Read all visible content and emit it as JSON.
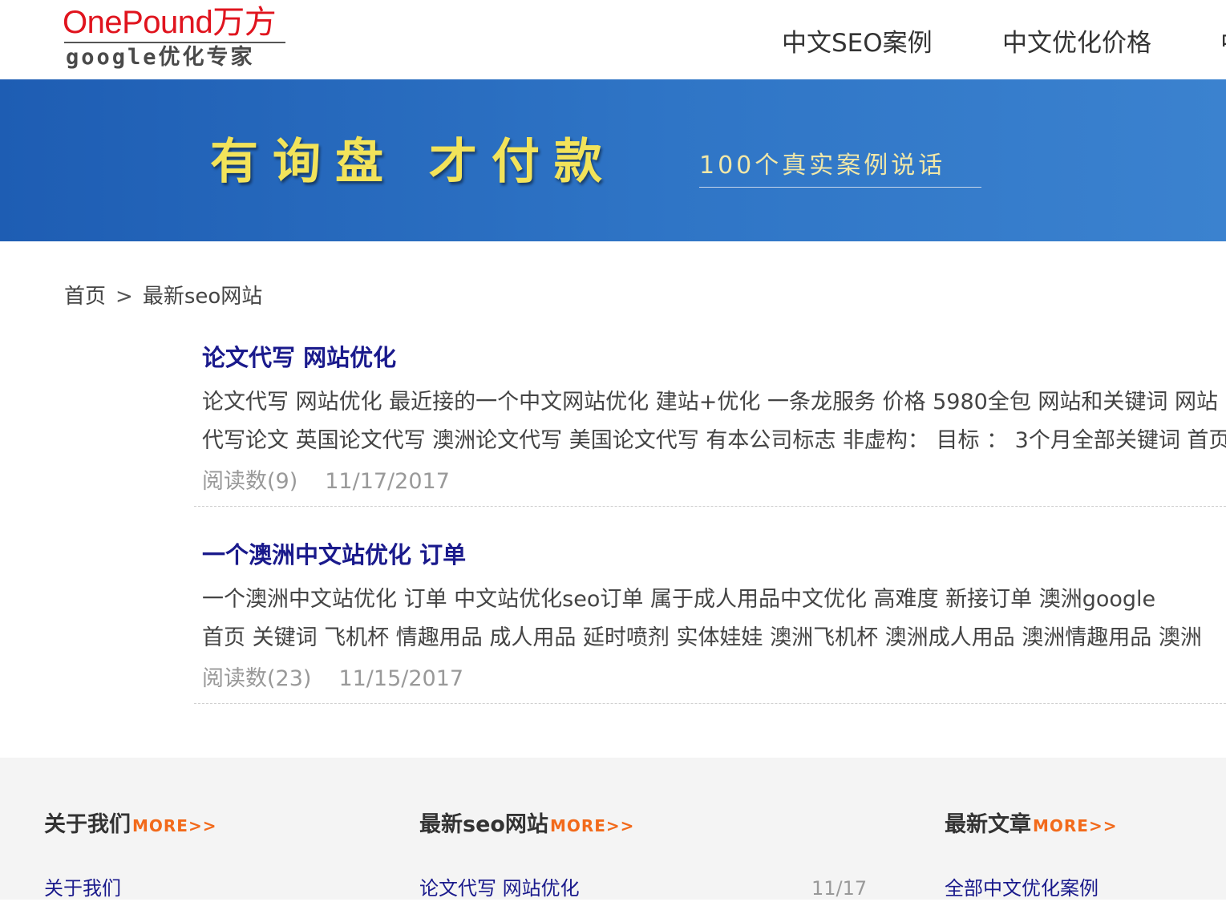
{
  "logo": {
    "brand": "OnePound万方",
    "tagline": "google优化专家"
  },
  "nav": [
    {
      "label": "中文SEO案例"
    },
    {
      "label": "中文优化价格"
    },
    {
      "label": "中"
    }
  ],
  "banner": {
    "headline": "有询盘 才付款",
    "subline": "100个真实案例说话"
  },
  "breadcrumb": {
    "home": "首页",
    "separator": ">",
    "current": "最新seo网站"
  },
  "articles": [
    {
      "title": "论文代写 网站优化",
      "summary_lines": [
        "论文代写 网站优化  最近接的一个中文网站优化 建站+优化 一条龙服务 价格 5980全包 网站和关键词 网站",
        "代写论文 英国论文代写 澳洲论文代写 美国论文代写  有本公司标志  非虚构： 目标  ：  3个月全部关键词 首页"
      ],
      "views": "阅读数(9)",
      "date": "11/17/2017"
    },
    {
      "title": "一个澳洲中文站优化 订单",
      "summary_lines": [
        "一个澳洲中文站优化 订单   中文站优化seo订单 属于成人用品中文优化  高难度  新接订单 澳洲google",
        "首页 关键词 飞机杯 情趣用品 成人用品 延时喷剂 实体娃娃 澳洲飞机杯 澳洲成人用品 澳洲情趣用品 澳洲"
      ],
      "views": "阅读数(23)",
      "date": "11/15/2017"
    }
  ],
  "footer": {
    "more_label": "MORE>>",
    "about": {
      "heading": "关于我们",
      "link": "关于我们"
    },
    "latest_sites": {
      "heading": "最新seo网站",
      "link": "论文代写 网站优化",
      "date": "11/17"
    },
    "latest_articles": {
      "heading": "最新文章",
      "link": "全部中文优化案例"
    }
  },
  "colors": {
    "brand_red": "#e0141e",
    "banner_blue": "#2f75c6",
    "title_blue": "#1a1a8c",
    "more_orange": "#f26a1b"
  }
}
